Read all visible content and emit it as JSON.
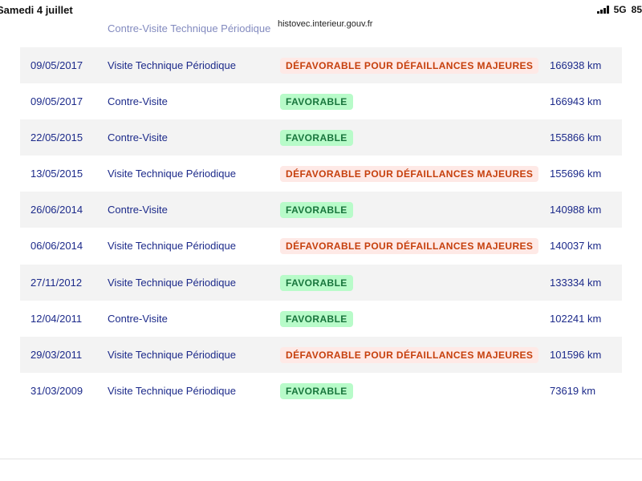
{
  "status_bar": {
    "date": "Samedi 4 juillet",
    "network": "5G",
    "battery": "85"
  },
  "browser": {
    "url": "histovec.interieur.gouv.fr"
  },
  "colors": {
    "text_primary": "#1c2a8a",
    "favorable_bg": "#b8fbc9",
    "favorable_text": "#18753c",
    "defavorable_bg": "#fee9e6",
    "defavorable_text": "#c63f0c",
    "row_shade": "#f3f3f3"
  },
  "inspections": [
    {
      "date": "",
      "type": "Contre-Visite Technique Périodique",
      "result": "",
      "result_kind": "defav",
      "km": ""
    },
    {
      "date": "09/05/2017",
      "type": "Visite Technique Périodique",
      "result": "DÉFAVORABLE POUR DÉFAILLANCES MAJEURES",
      "result_kind": "defav",
      "km": "166938 km"
    },
    {
      "date": "09/05/2017",
      "type": "Contre-Visite",
      "result": "FAVORABLE",
      "result_kind": "fav",
      "km": "166943 km"
    },
    {
      "date": "22/05/2015",
      "type": "Contre-Visite",
      "result": "FAVORABLE",
      "result_kind": "fav",
      "km": "155866 km"
    },
    {
      "date": "13/05/2015",
      "type": "Visite Technique Périodique",
      "result": "DÉFAVORABLE POUR DÉFAILLANCES MAJEURES",
      "result_kind": "defav",
      "km": "155696 km"
    },
    {
      "date": "26/06/2014",
      "type": "Contre-Visite",
      "result": "FAVORABLE",
      "result_kind": "fav",
      "km": "140988 km"
    },
    {
      "date": "06/06/2014",
      "type": "Visite Technique Périodique",
      "result": "DÉFAVORABLE POUR DÉFAILLANCES MAJEURES",
      "result_kind": "defav",
      "km": "140037 km"
    },
    {
      "date": "27/11/2012",
      "type": "Visite Technique Périodique",
      "result": "FAVORABLE",
      "result_kind": "fav",
      "km": "133334 km"
    },
    {
      "date": "12/04/2011",
      "type": "Contre-Visite",
      "result": "FAVORABLE",
      "result_kind": "fav",
      "km": "102241 km"
    },
    {
      "date": "29/03/2011",
      "type": "Visite Technique Périodique",
      "result": "DÉFAVORABLE POUR DÉFAILLANCES MAJEURES",
      "result_kind": "defav",
      "km": "101596 km"
    },
    {
      "date": "31/03/2009",
      "type": "Visite Technique Périodique",
      "result": "FAVORABLE",
      "result_kind": "fav",
      "km": "73619 km"
    }
  ]
}
